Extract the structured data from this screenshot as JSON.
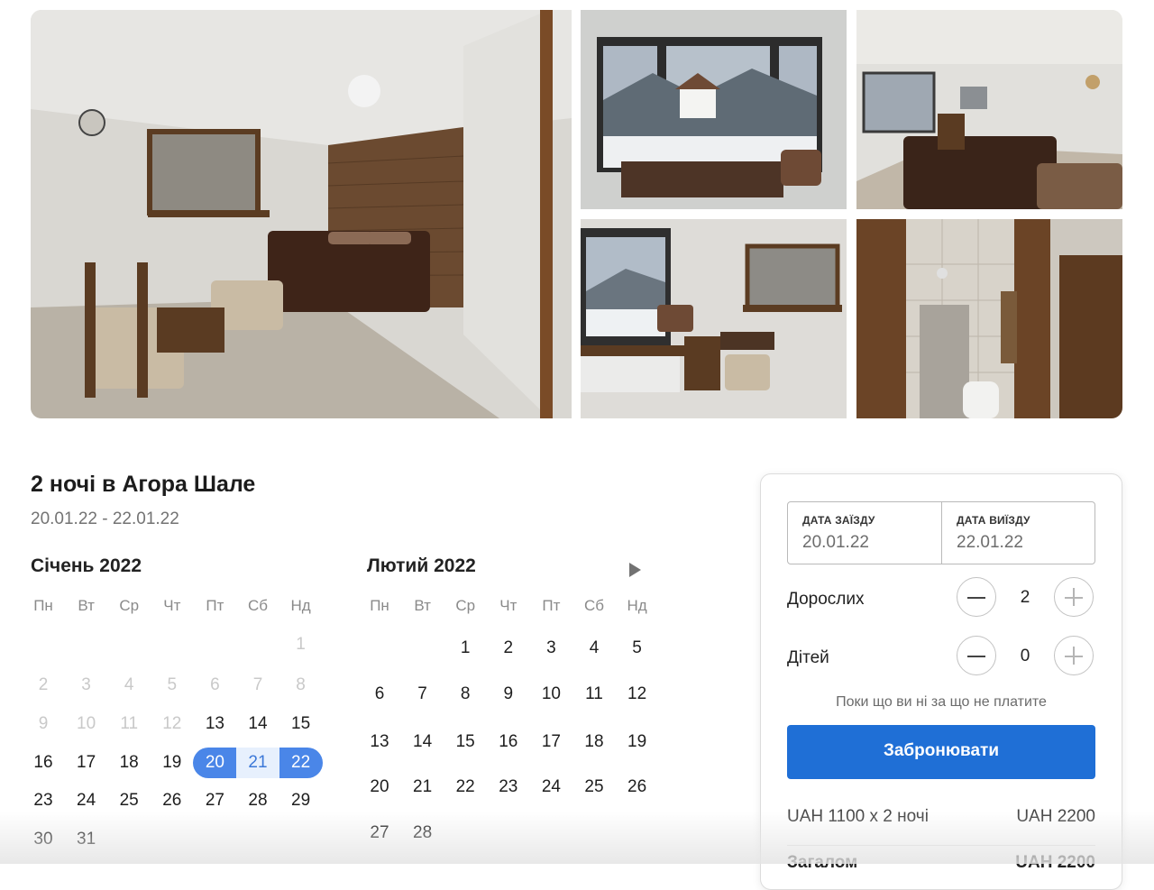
{
  "listing": {
    "title": "2 ночі в Агора Шале",
    "dates": "20.01.22 - 22.01.22"
  },
  "calendar": {
    "weekdays": [
      "Пн",
      "Вт",
      "Ср",
      "Чт",
      "Пт",
      "Сб",
      "Нд"
    ],
    "next_icon": "play-triangle-icon",
    "months": [
      {
        "title": "Січень 2022",
        "weeks": [
          [
            "",
            "",
            "",
            "",
            "",
            "",
            "1"
          ],
          [
            "2",
            "3",
            "4",
            "5",
            "6",
            "7",
            "8"
          ],
          [
            "9",
            "10",
            "11",
            "12",
            "13",
            "14",
            "15"
          ],
          [
            "16",
            "17",
            "18",
            "19",
            "20",
            "21",
            "22"
          ],
          [
            "23",
            "24",
            "25",
            "26",
            "27",
            "28",
            "29"
          ],
          [
            "30",
            "31",
            "",
            "",
            "",
            "",
            ""
          ]
        ]
      },
      {
        "title": "Лютий 2022",
        "weeks": [
          [
            "",
            "",
            "1",
            "2",
            "3",
            "4",
            "5"
          ],
          [
            "6",
            "7",
            "8",
            "9",
            "10",
            "11",
            "12"
          ],
          [
            "13",
            "14",
            "15",
            "16",
            "17",
            "18",
            "19"
          ],
          [
            "20",
            "21",
            "22",
            "23",
            "24",
            "25",
            "26"
          ],
          [
            "27",
            "28",
            "",
            "",
            "",
            "",
            ""
          ]
        ]
      }
    ],
    "selected_range": [
      "20",
      "22"
    ],
    "selected_color": "#4a86e8"
  },
  "booking": {
    "checkin_label": "ДАТА ЗАЇЗДУ",
    "checkin_value": "20.01.22",
    "checkout_label": "ДАТА ВИЇЗДУ",
    "checkout_value": "22.01.22",
    "adults_label": "Дорослих",
    "adults_count": "2",
    "children_label": "Дітей",
    "children_count": "0",
    "note": "Поки що ви ні за що не платите",
    "book_button": "Забронювати",
    "price_line": "UAH 1100 x 2 ночі",
    "price_value": "UAH 2200",
    "total_label": "Загалом",
    "total_value": "UAH 2200",
    "accent_color": "#1f6fd6"
  }
}
